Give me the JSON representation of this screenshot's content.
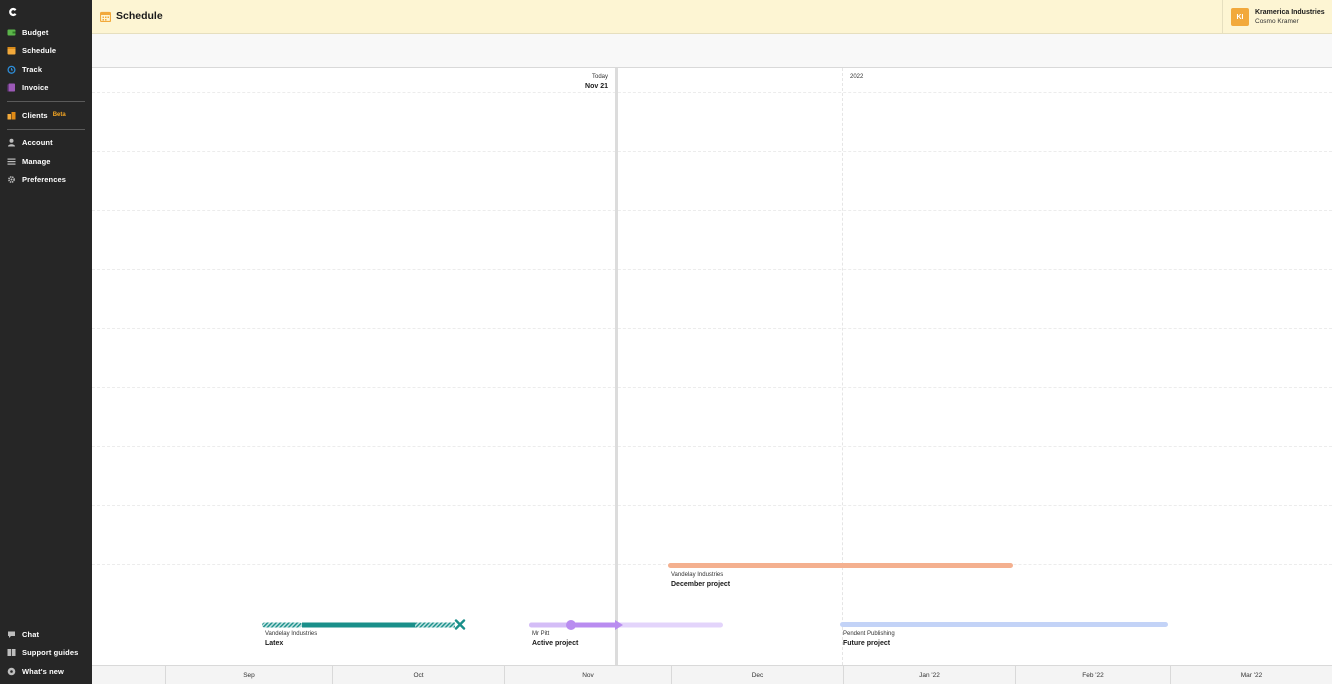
{
  "app": {
    "logo_letter": "C"
  },
  "sidebar": {
    "items": [
      {
        "label": "Budget",
        "icon": "budget-icon",
        "color": "#5bb54a"
      },
      {
        "label": "Schedule",
        "icon": "calendar-icon",
        "color": "#f2a93b"
      },
      {
        "label": "Track",
        "icon": "clock-icon",
        "color": "#2d8cd6"
      },
      {
        "label": "Invoice",
        "icon": "invoice-icon",
        "color": "#9b59b6"
      }
    ],
    "clients": {
      "label": "Clients",
      "badge": "Beta",
      "icon": "clients-icon",
      "color": "#f2a93b"
    },
    "settings": [
      {
        "label": "Account",
        "icon": "user-icon"
      },
      {
        "label": "Manage",
        "icon": "list-icon"
      },
      {
        "label": "Preferences",
        "icon": "gear-icon"
      }
    ],
    "bottom": [
      {
        "label": "Chat",
        "icon": "chat-icon"
      },
      {
        "label": "Support guides",
        "icon": "book-icon"
      },
      {
        "label": "What's new",
        "icon": "info-icon"
      }
    ]
  },
  "header": {
    "title": "Schedule",
    "icon": "calendar-icon",
    "background": "#fdf5d3",
    "org": {
      "initials": "KI",
      "company": "Kramerica Industries",
      "person": "Cosmo Kramer",
      "color": "#f2a93b"
    }
  },
  "timeline": {
    "today_label": "Today",
    "today_date": "Nov 21",
    "year_label": "2022",
    "projects": [
      {
        "client": "Vandelay Industries",
        "name": "December project",
        "color": "#f4b08f"
      },
      {
        "client": "Vandelay Industries",
        "name": "Latex",
        "color": "#1a8f8a",
        "status": "cancelled"
      },
      {
        "client": "Mr Pitt",
        "name": "Active project",
        "color": "#b98cf0",
        "status": "active"
      },
      {
        "client": "Pendent Publishing",
        "name": "Future project",
        "color": "#c3d3f7"
      }
    ],
    "months": [
      "Sep",
      "Oct",
      "Nov",
      "Dec",
      "Jan '22",
      "Feb '22",
      "Mar '22"
    ]
  }
}
